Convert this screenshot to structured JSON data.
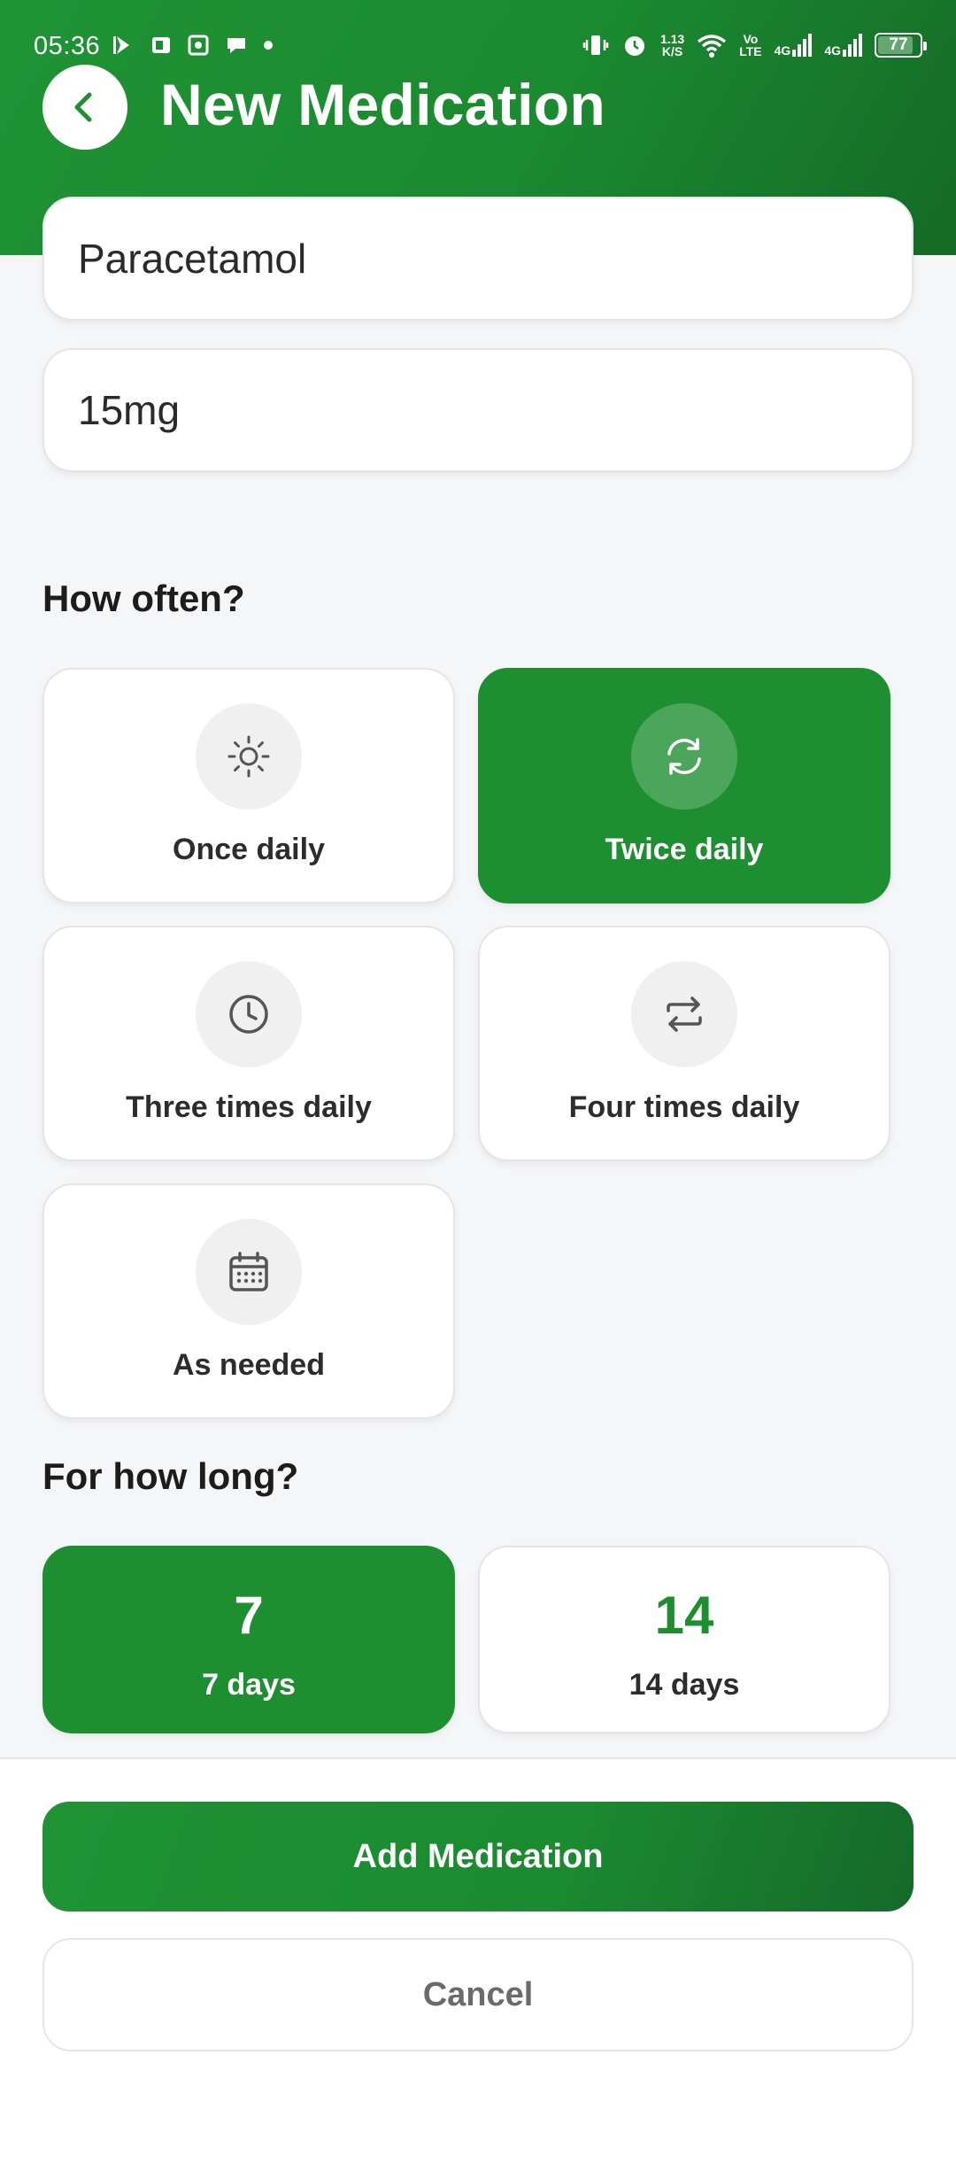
{
  "status_bar": {
    "time": "05:36",
    "speed_value": "1.13",
    "speed_unit": "K/S",
    "volte_top": "Vo",
    "volte_bottom": "LTE",
    "signal1": "4G",
    "signal2": "4G",
    "battery": "77"
  },
  "header": {
    "title": "New Medication",
    "back_icon": "chevron-left-icon"
  },
  "form": {
    "name_value": "Paracetamol",
    "dose_value": "15mg"
  },
  "frequency": {
    "title": "How often?",
    "options": [
      {
        "label": "Once daily",
        "icon": "sun-icon",
        "selected": false
      },
      {
        "label": "Twice daily",
        "icon": "sync-icon",
        "selected": true
      },
      {
        "label": "Three times daily",
        "icon": "clock-icon",
        "selected": false
      },
      {
        "label": "Four times daily",
        "icon": "repeat-icon",
        "selected": false
      },
      {
        "label": "As needed",
        "icon": "calendar-icon",
        "selected": false
      }
    ]
  },
  "duration": {
    "title": "For how long?",
    "options": [
      {
        "number": "7",
        "label": "7 days",
        "selected": true
      },
      {
        "number": "14",
        "label": "14 days",
        "selected": false
      }
    ]
  },
  "actions": {
    "add_label": "Add Medication",
    "cancel_label": "Cancel"
  },
  "colors": {
    "brand_green": "#1e8f31",
    "brand_dark_green": "#146a26",
    "background": "#f5f6f8"
  }
}
